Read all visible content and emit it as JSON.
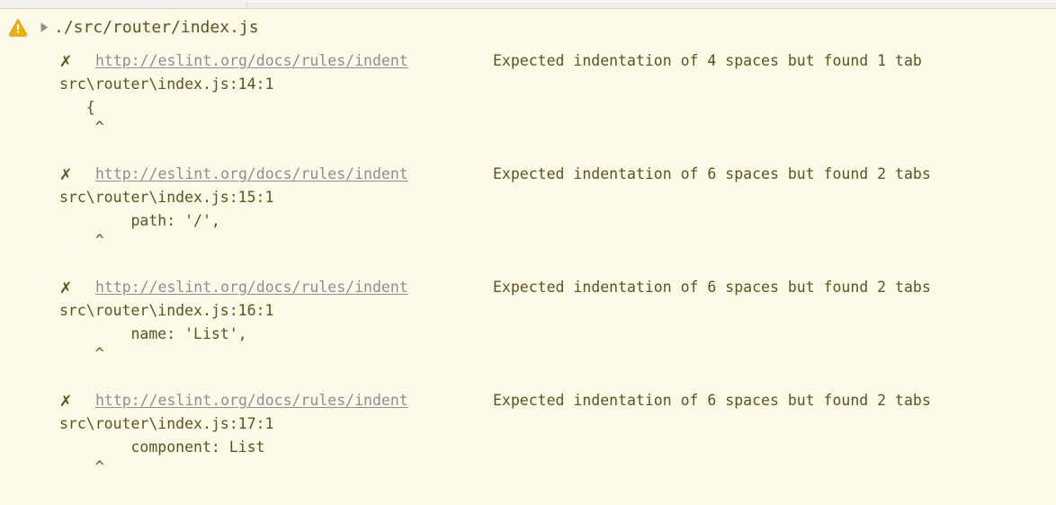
{
  "window": {
    "background_color": "#fdfbe7",
    "top_strip_color": "#eff0f1"
  },
  "file_header": {
    "warning_icon": "warning-triangle-icon",
    "warning_icon_color": "#edb211",
    "disclosure_icon": "disclosure-triangle-collapsed-icon",
    "disclosure_icon_color": "#8f8f8f",
    "path": "./src/router/index.js",
    "text_color": "#5a5322"
  },
  "problems": [
    {
      "severity_mark": "✗",
      "rule_url": "http://eslint.org/docs/rules/indent",
      "message": "Expected indentation of 4 spaces but found 1 tab",
      "location": "src\\router\\index.js:14:1",
      "code": "   {",
      "caret": "    ^"
    },
    {
      "severity_mark": "✗",
      "rule_url": "http://eslint.org/docs/rules/indent",
      "message": "Expected indentation of 6 spaces but found 2 tabs",
      "location": "src\\router\\index.js:15:1",
      "code": "        path: '/',",
      "caret": "    ^"
    },
    {
      "severity_mark": "✗",
      "rule_url": "http://eslint.org/docs/rules/indent",
      "message": "Expected indentation of 6 spaces but found 2 tabs",
      "location": "src\\router\\index.js:16:1",
      "code": "        name: 'List',",
      "caret": "    ^"
    },
    {
      "severity_mark": "✗",
      "rule_url": "http://eslint.org/docs/rules/indent",
      "message": "Expected indentation of 6 spaces but found 2 tabs",
      "location": "src\\router\\index.js:17:1",
      "code": "        component: List",
      "caret": "    ^"
    }
  ],
  "colors": {
    "url": "#8d8d98",
    "text": "#5a5322",
    "warning": "#edb211"
  }
}
